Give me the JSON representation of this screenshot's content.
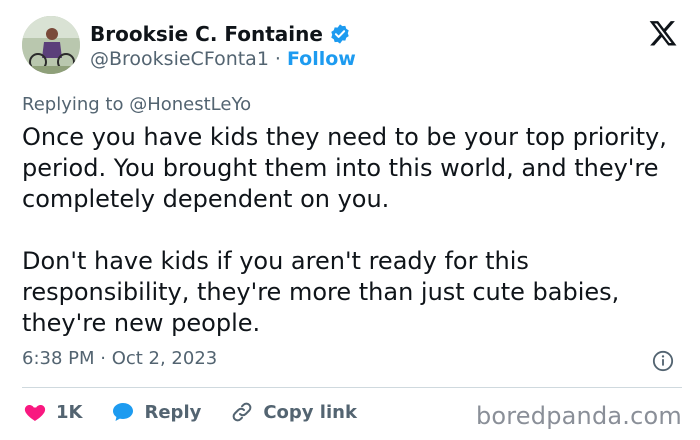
{
  "author": {
    "name": "Brooksie C. Fontaine",
    "handle": "@BrooksieCFonta1",
    "separator": "·",
    "follow_label": "Follow"
  },
  "reply": {
    "prefix": "Replying to",
    "to": "@HonestLeYo"
  },
  "tweet": {
    "paragraphs": [
      "Once you have kids they need to be your top priority, period. You brought them into this world, and they're completely dependent on you.",
      "Don't have kids if you aren't ready for this responsibility, they're more than just cute babies, they're new people."
    ],
    "timestamp": "6:38 PM · Oct 2, 2023"
  },
  "actions": {
    "like_count": "1K",
    "reply_label": "Reply",
    "copy_link_label": "Copy link"
  },
  "watermark": "boredpanda.com",
  "colors": {
    "accent": "#1d9bf0",
    "like": "#f91880",
    "text": "#0f1419",
    "muted": "#536471"
  },
  "icons": [
    "verified-badge-icon",
    "x-logo-icon",
    "info-icon",
    "heart-icon",
    "reply-bubble-icon",
    "link-icon"
  ]
}
